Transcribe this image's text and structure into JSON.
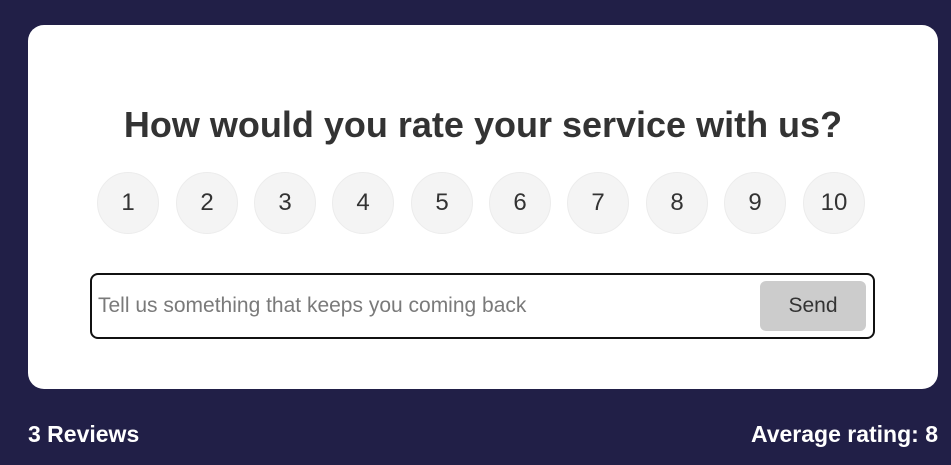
{
  "card": {
    "question": "How would you rate your service with us?",
    "ratings": [
      "1",
      "2",
      "3",
      "4",
      "5",
      "6",
      "7",
      "8",
      "9",
      "10"
    ],
    "review_input": {
      "value": "",
      "placeholder": "Tell us something that keeps you coming back"
    },
    "send_label": "Send"
  },
  "stats": {
    "review_count": "3 Reviews",
    "average_rating": "Average rating: 8"
  },
  "colors": {
    "background": "#211f47",
    "card": "#ffffff",
    "rating_circle": "#f4f4f4",
    "send_button": "#cccccc",
    "text": "#333333"
  }
}
